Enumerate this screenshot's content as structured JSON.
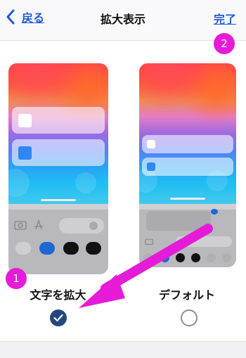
{
  "nav": {
    "back_label": "戻る",
    "title": "拡大表示",
    "done_label": "完了"
  },
  "options": [
    {
      "label": "文字を拡大",
      "selected": true
    },
    {
      "label": "デフォルト",
      "selected": false
    }
  ],
  "annotations": [
    {
      "number": "1"
    },
    {
      "number": "2"
    }
  ],
  "colors": {
    "link": "#1f5bd7",
    "check_fill": "#24477c",
    "annotation": "#e61bd8"
  }
}
